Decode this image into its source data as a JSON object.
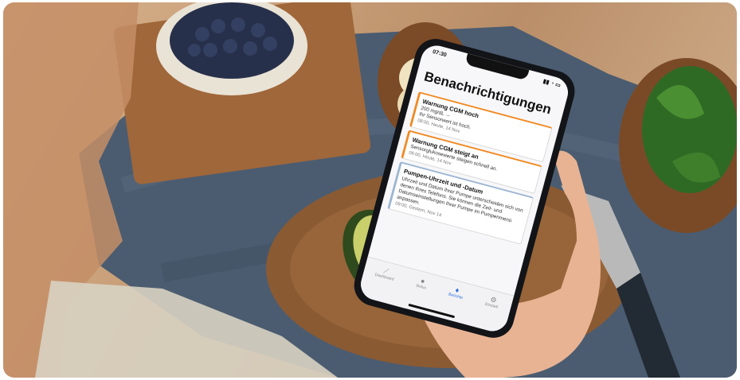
{
  "phone": {
    "time": "07:30",
    "screen_title": "Benachrichtigungen",
    "notifications": [
      {
        "title": "Warnung CGM hoch",
        "lines": [
          "200 mg/dL →",
          "Ihr Sensorwert ist hoch."
        ],
        "meta": "08:00, Heute, 14 Nov"
      },
      {
        "title": "Warnung CGM steigt an",
        "lines": [
          "Sensorglukosewerte steigen schnell an."
        ],
        "meta": "06:00, Heute, 14 Nov"
      },
      {
        "title": "Pumpen-Uhrzeit und -Datum",
        "lines": [
          "Uhrzeit und Datum Ihrer Pumpe unterscheiden sich von denen Ihres Telefons. Sie können die Zeit- und Datumseinstellungen Ihrer Pumpe im Pumpenmenü anpassen."
        ],
        "meta": "09:00, Gestern, Nov 14"
      }
    ],
    "tabs": [
      {
        "label": "Dashboard",
        "icon": "chart-icon"
      },
      {
        "label": "Bolus",
        "icon": "drop-icon"
      },
      {
        "label": "Berichte",
        "icon": "bell-icon"
      },
      {
        "label": "Einstell.",
        "icon": "gear-icon"
      }
    ],
    "active_tab": "Berichte"
  },
  "colors": {
    "warning": "#f08a24",
    "info": "#9db5d2",
    "accent": "#2b6ee0"
  }
}
